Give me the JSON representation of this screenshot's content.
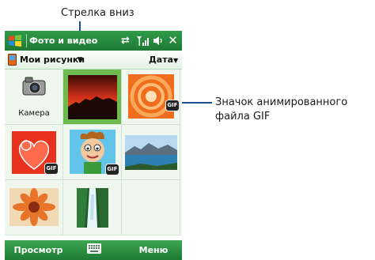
{
  "callouts": {
    "dropdown_arrow": "Стрелка вниз",
    "gif_icon_line1": "Значок анимированного",
    "gif_icon_line2": "файла GIF"
  },
  "titlebar": {
    "title": "Фото и видео",
    "icons": [
      "windows-logo",
      "sync-icon",
      "signal-icon",
      "speaker-icon",
      "close-icon"
    ]
  },
  "toolbar": {
    "folder": "Мои рисунки",
    "sort": "Дата"
  },
  "grid": {
    "items": [
      {
        "type": "camera",
        "label": "Камера"
      },
      {
        "type": "image",
        "name": "sunset"
      },
      {
        "type": "image",
        "name": "orange-circles",
        "animated_gif": true
      },
      {
        "type": "image",
        "name": "red-heart",
        "animated_gif": true
      },
      {
        "type": "image",
        "name": "cartoon-person",
        "animated_gif": true
      },
      {
        "type": "image",
        "name": "mountain-lake"
      },
      {
        "type": "image",
        "name": "flower"
      },
      {
        "type": "image",
        "name": "waterfall"
      }
    ],
    "gif_badge_text": "GIF"
  },
  "softkeys": {
    "left": "Просмотр",
    "right": "Меню"
  },
  "colors": {
    "titlebar": "#22843b",
    "selection": "#6dbb4c",
    "callout_line": "#1d4e91"
  }
}
